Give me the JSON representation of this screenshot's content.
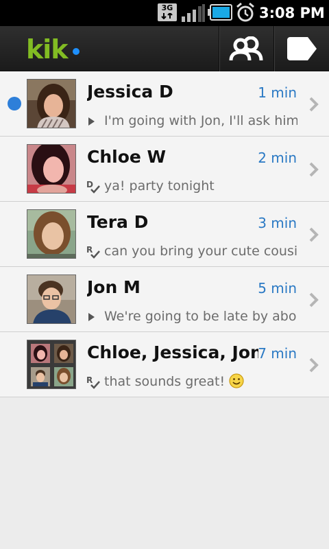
{
  "status_bar": {
    "network": "3G",
    "time": "3:08 PM",
    "icons": [
      "network-3g-icon",
      "signal-bars-icon",
      "battery-icon",
      "alarm-clock-icon"
    ]
  },
  "app": {
    "logo": "kik",
    "brand_color": "#82bc23",
    "actions": [
      {
        "icon": "contacts-icon"
      },
      {
        "icon": "compose-icon"
      }
    ]
  },
  "conversations": [
    {
      "name": "Jessica D",
      "time": "1 min",
      "preview": "I'm going with Jon, I'll ask him",
      "status_icon": "sent-arrow-icon",
      "unread": true
    },
    {
      "name": "Chloe W",
      "time": "2 min",
      "preview": "ya! party tonight",
      "status_icon": "delivered-check-icon",
      "unread": false
    },
    {
      "name": "Tera D",
      "time": "3 min",
      "preview": "can you bring your cute cousi..",
      "status_icon": "read-check-icon",
      "unread": false
    },
    {
      "name": "Jon M",
      "time": "5 min",
      "preview": "We're going to be late by abo..",
      "status_icon": "sent-arrow-icon",
      "unread": false
    },
    {
      "name": "Chloe, Jessica, Jon",
      "name_suffix": ",",
      "time": "7 min",
      "preview": "that sounds great! ",
      "status_icon": "read-check-icon",
      "emoji": "smiley-emoji-icon",
      "unread": false
    }
  ],
  "colors": {
    "time_text": "#2a79c4",
    "unread_dot": "#2e7fd9"
  }
}
